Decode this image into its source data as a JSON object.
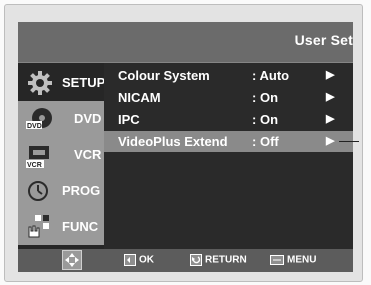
{
  "header": {
    "title": "User Set"
  },
  "sidebar": {
    "items": [
      {
        "label": "SETUP",
        "icon": "gear-icon",
        "active": true
      },
      {
        "label": "DVD",
        "icon": "dvd-icon",
        "badge": "DVD"
      },
      {
        "label": "VCR",
        "icon": "vcr-tape-icon",
        "badge": "VCR"
      },
      {
        "label": "PROG",
        "icon": "clock-icon"
      },
      {
        "label": "FUNC",
        "icon": "hand-grid-icon"
      }
    ]
  },
  "menu": {
    "rows": [
      {
        "label": "Colour System",
        "sep": ":",
        "value": "Auto",
        "arrow": "▶"
      },
      {
        "label": "NICAM",
        "sep": ":",
        "value": "On",
        "arrow": "▶"
      },
      {
        "label": "IPC",
        "sep": ":",
        "value": "On",
        "arrow": "▶"
      },
      {
        "label": "VideoPlus Extend",
        "sep": ":",
        "value": "Off",
        "arrow": "▶",
        "selected": true
      }
    ]
  },
  "footer": {
    "ok": "OK",
    "return": "RETURN",
    "menu": "MENU"
  },
  "colors": {
    "screen_bg": "#2d2d2d",
    "sidebar_inactive": "#9a9a9a",
    "highlight": "#8a8a8a",
    "text": "#ffffff"
  }
}
